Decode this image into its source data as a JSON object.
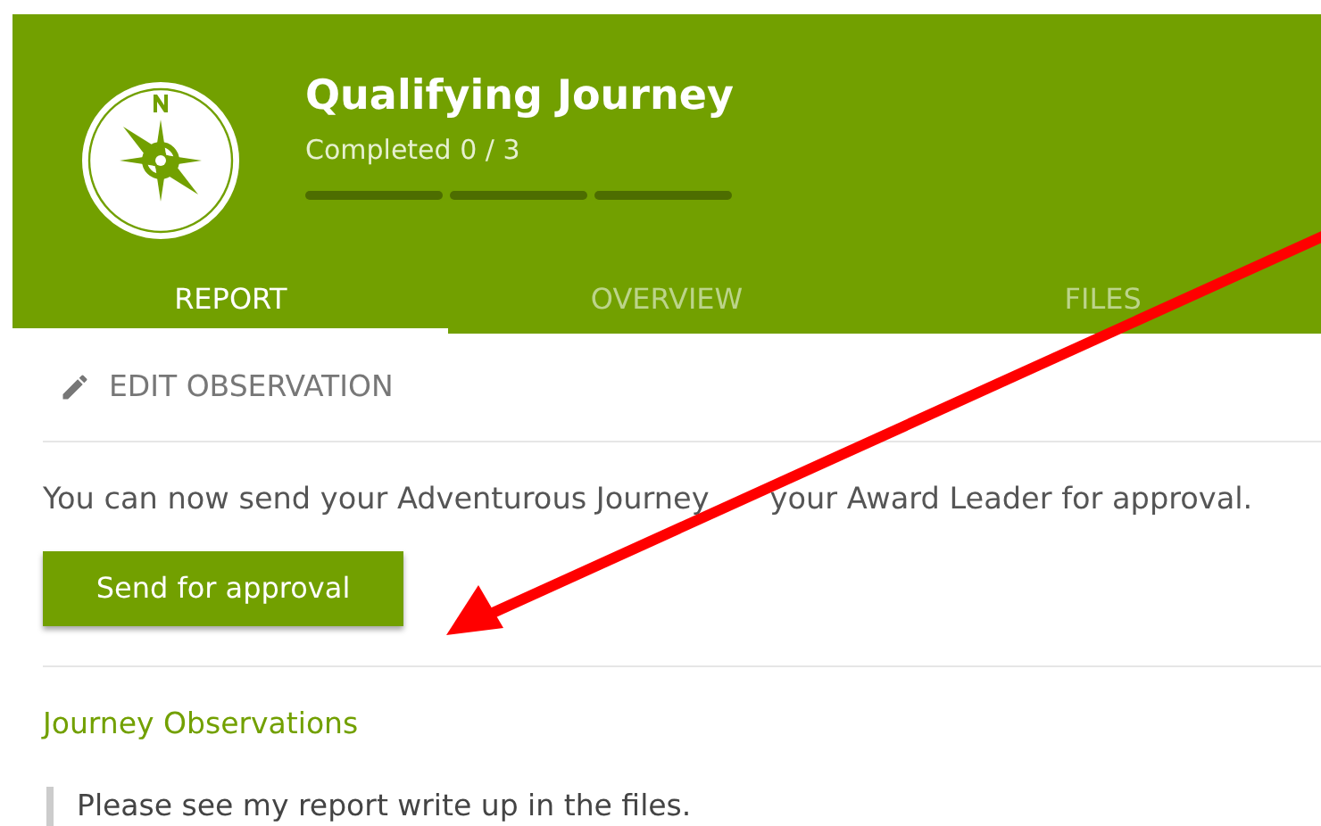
{
  "header": {
    "title": "Qualifying Journey",
    "progress_text": "Completed 0 / 3",
    "steps": [
      {
        "done": false
      },
      {
        "done": false
      },
      {
        "done": false
      }
    ]
  },
  "tabs": [
    {
      "label": "REPORT",
      "selected": true
    },
    {
      "label": "OVERVIEW",
      "selected": false
    },
    {
      "label": "FILES",
      "selected": false
    }
  ],
  "edit_link": "EDIT OBSERVATION",
  "notice": {
    "before_arrow": "You can now send your Adventurous Journey",
    "after_arrow": "your Award Leader for approval."
  },
  "send_button": "Send for approval",
  "observations": {
    "heading": "Journey Observations",
    "quote": "Please see my report write up in the files."
  },
  "annotation": {
    "kind": "arrow"
  }
}
